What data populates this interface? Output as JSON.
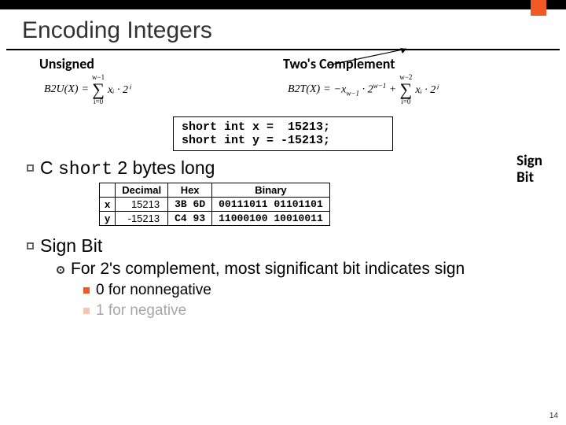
{
  "title": "Encoding Integers",
  "formulas": {
    "unsigned": {
      "heading": "Unsigned",
      "fn": "B2U(X)",
      "eq": "=",
      "sum_upper": "w−1",
      "sum_lower": "i=0",
      "body": "xᵢ · 2ⁱ"
    },
    "twos": {
      "heading": "Two's Complement",
      "fn": "B2T(X)",
      "eq": "=",
      "lead": "−x",
      "lead_sub": "w−1",
      "lead_exp": "w−1",
      "dot": " · 2",
      "plus": " + ",
      "sum_upper": "w−2",
      "sum_lower": "i=0",
      "body": "xᵢ · 2ⁱ"
    }
  },
  "codebox": "short int x =  15213;\nshort int y = -15213;",
  "sign_bit_label_l1": "Sign",
  "sign_bit_label_l2": "Bit",
  "bullet_c_short_pre": "C ",
  "bullet_c_short_mono": "short",
  "bullet_c_short_post": " 2 bytes long",
  "table": {
    "headers": [
      "",
      "Decimal",
      "Hex",
      "Binary"
    ],
    "rows": [
      {
        "hdr": "x",
        "dec": "15213",
        "hex": "3B 6D",
        "bin": "00111011 01101101"
      },
      {
        "hdr": "y",
        "dec": "-15213",
        "hex": "C4 93",
        "bin": "11000100 10010011"
      }
    ]
  },
  "bullet_signbit": "Sign Bit",
  "sub_for": "For 2's complement, most significant bit indicates sign",
  "subsub_0": "0 for nonnegative",
  "subsub_1": "1 for negative",
  "page_num": "14"
}
